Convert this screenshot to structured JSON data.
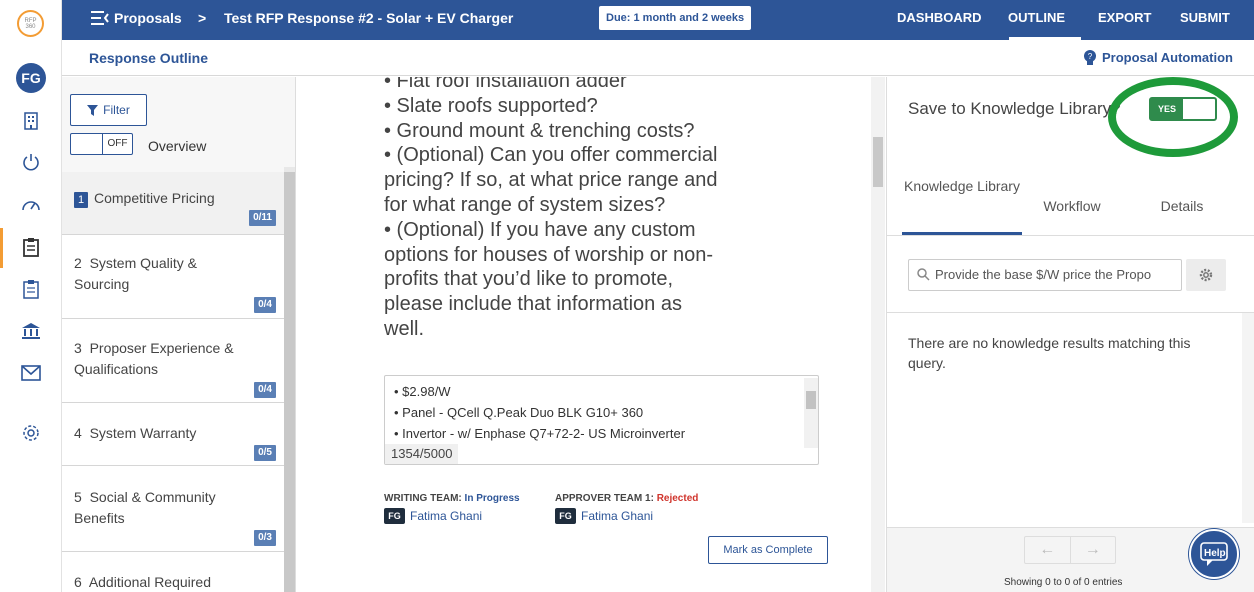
{
  "rail": {
    "logo_text": "RFP 360",
    "avatar": "FG"
  },
  "header": {
    "back_label": "Proposals",
    "separator": ">",
    "title": "Test RFP Response #2 - Solar + EV Charger",
    "due_badge": "Due: 1 month and 2 weeks",
    "nav": [
      "DASHBOARD",
      "OUTLINE",
      "EXPORT",
      "SUBMIT"
    ],
    "active_nav": "OUTLINE"
  },
  "subheader": {
    "title": "Response Outline",
    "automation_link": "Proposal Automation"
  },
  "outline": {
    "filter_label": "Filter",
    "overview_toggle_state": "OFF",
    "overview_label": "Overview",
    "sections": [
      {
        "number": "1",
        "label": "Competitive Pricing",
        "count": "0/11",
        "active": true
      },
      {
        "number": "2",
        "label": "System Quality & Sourcing",
        "count": "0/4"
      },
      {
        "number": "3",
        "label": "Proposer Experience & Qualifications",
        "count": "0/4"
      },
      {
        "number": "4",
        "label": "System Warranty",
        "count": "0/5"
      },
      {
        "number": "5",
        "label": "Social & Community Benefits",
        "count": "0/3"
      },
      {
        "number": "6",
        "label": "Additional Required",
        "count": ""
      }
    ]
  },
  "question": {
    "lines": [
      "• Flat roof installation adder",
      "• Slate roofs supported?",
      "• Ground mount & trenching costs?",
      "• (Optional) Can you offer commercial",
      "pricing? If so, at what price range and",
      "for what range of system sizes?",
      "• (Optional) If you have any custom",
      "options for houses of worship or non-",
      "profits that you’d like to promote,",
      "please include that information as",
      "well."
    ]
  },
  "answer": {
    "lines": [
      "• $2.98/W",
      "• Panel - QCell Q.Peak Duo BLK G10+ 360",
      "• Invertor - w/ Enphase Q7+72-2- US Microinverter"
    ],
    "char_count": "1354/5000"
  },
  "teams": {
    "writing_label": "WRITING TEAM:",
    "writing_status": "In Progress",
    "writing_status_color": "#2d5597",
    "writing_member": "Fatima Ghani",
    "approver_label": "APPROVER TEAM 1:",
    "approver_status": "Rejected",
    "approver_status_color": "#d0342c",
    "approver_member": "Fatima Ghani",
    "member_initials": "FG"
  },
  "mark_complete_label": "Mark as Complete",
  "knowledge": {
    "save_label": "Save to Knowledge Library?",
    "toggle_state": "YES",
    "tabs": [
      "Knowledge Library",
      "Workflow",
      "Details"
    ],
    "active_tab": "Knowledge Library",
    "search_value": "Provide the base $/W price the Propo",
    "empty_message": "There are no knowledge results matching this query.",
    "showing": "Showing 0 to 0 of 0 entries",
    "help_label": "Help"
  },
  "colors": {
    "brand": "#2d5597",
    "accent_orange": "#f39c34",
    "highlight_green": "#1e9a3a"
  }
}
